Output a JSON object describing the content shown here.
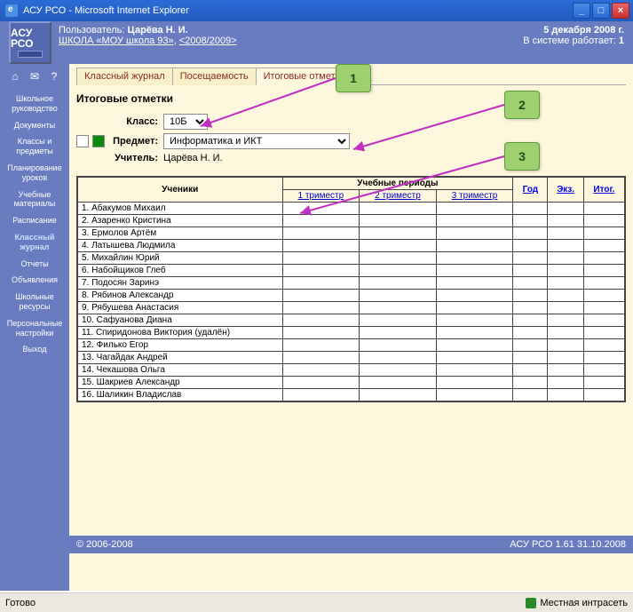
{
  "window": {
    "title": "АСУ РСО - Microsoft Internet Explorer"
  },
  "header": {
    "logo": "АСУ РСО",
    "user_label": "Пользователь:",
    "user_name": "Царёва Н. И.",
    "school_label": "ШКОЛА",
    "school_name": "«МОУ школа 93»",
    "year": "<2008/2009>",
    "date": "5 декабря 2008 г.",
    "online_label": "В системе работает:",
    "online_count": "1"
  },
  "sidebar": {
    "items": [
      "Школьное руководство",
      "Документы",
      "Классы и предметы",
      "Планирование уроков",
      "Учебные материалы",
      "Расписание",
      "Классный журнал",
      "Отчеты",
      "Объявления",
      "Школьные ресурсы",
      "Персональные настройки",
      "Выход"
    ],
    "active_index": 6
  },
  "tabs": {
    "items": [
      "Классный журнал",
      "Посещаемость",
      "Итоговые отметки"
    ],
    "active_index": 2
  },
  "page": {
    "title": "Итоговые отметки",
    "class_label": "Класс:",
    "class_value": "10Б",
    "subject_label": "Предмет:",
    "subject_value": "Информатика и ИКТ",
    "teacher_label": "Учитель:",
    "teacher_value": "Царёва Н. И."
  },
  "table": {
    "students_header": "Ученики",
    "periods_header": "Учебные периоды",
    "subheaders": [
      "1 триместр",
      "2 триместр",
      "3 триместр"
    ],
    "col_year": "Год",
    "col_exam": "Экз.",
    "col_final": "Итог.",
    "rows": [
      "Абакумов Михаил",
      "Азаренко Кристина",
      "Ермолов Артём",
      "Латышева Людмила",
      "Михайлин Юрий",
      "Набойщиков Глеб",
      "Подосян Заринэ",
      "Рябинов Александр",
      "Рябушева Анастасия",
      "Сафуанова Диана",
      "Спиридонова Виктория (удалён)",
      "Филько Егор",
      "Чагайдак Андрей",
      "Чекашова Ольга",
      "Шакриев Александр",
      "Шаликин Владислав"
    ]
  },
  "callouts": {
    "c1": "1",
    "c2": "2",
    "c3": "3"
  },
  "footer": {
    "copyright": "© 2006-2008",
    "version": "АСУ РСО 1.61   31.10.2008"
  },
  "status": {
    "done": "Готово",
    "zone": "Местная интрасеть"
  }
}
